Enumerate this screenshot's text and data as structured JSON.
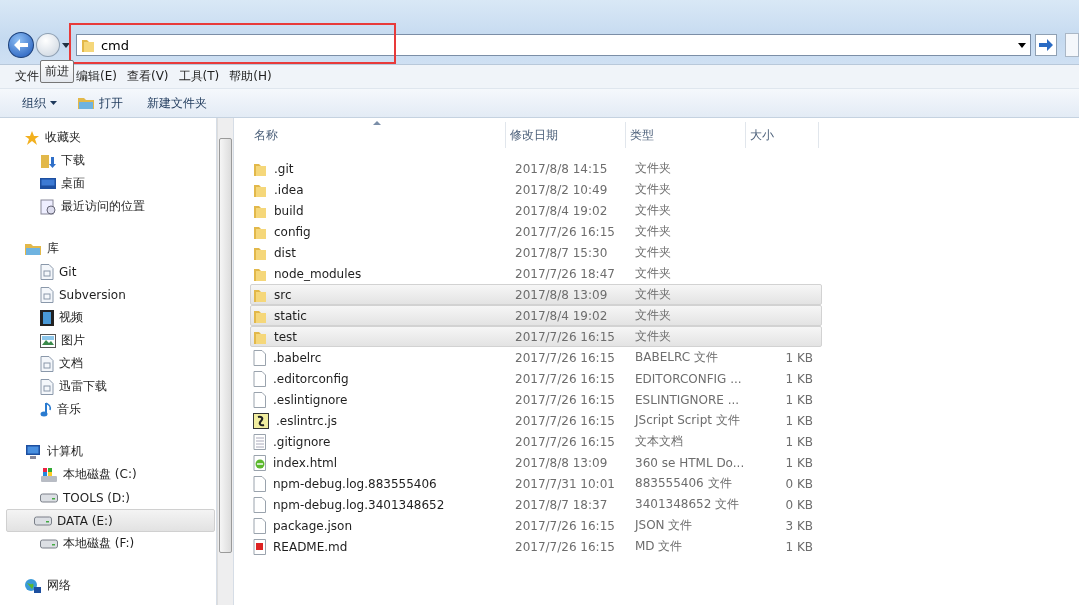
{
  "address_bar": {
    "value": "cmd"
  },
  "tooltip": {
    "text": "前进"
  },
  "menu": [
    "文件",
    "编辑(E)",
    "查看(V)",
    "工具(T)",
    "帮助(H)"
  ],
  "toolbar": [
    {
      "label": "组织",
      "kind": "dropdown"
    },
    {
      "label": "打开",
      "kind": "open"
    },
    {
      "label": "新建文件夹",
      "kind": "plain"
    }
  ],
  "sidebar": {
    "groups": [
      {
        "label": "收藏夹",
        "kind": "star",
        "children": [
          {
            "label": "下载",
            "kind": "download",
            "selected": false
          },
          {
            "label": "桌面",
            "kind": "desktop",
            "selected": false
          },
          {
            "label": "最近访问的位置",
            "kind": "recent",
            "selected": false
          }
        ]
      },
      {
        "label": "库",
        "kind": "library",
        "children": [
          {
            "label": "Git",
            "kind": "doc",
            "selected": false
          },
          {
            "label": "Subversion",
            "kind": "doc",
            "selected": false
          },
          {
            "label": "视频",
            "kind": "film",
            "selected": false
          },
          {
            "label": "图片",
            "kind": "image",
            "selected": false
          },
          {
            "label": "文档",
            "kind": "doc",
            "selected": false
          },
          {
            "label": "迅雷下载",
            "kind": "doc",
            "selected": false
          },
          {
            "label": "音乐",
            "kind": "music",
            "selected": false
          }
        ]
      },
      {
        "label": "计算机",
        "kind": "computer",
        "children": [
          {
            "label": "本地磁盘 (C:)",
            "kind": "system-drive",
            "selected": false
          },
          {
            "label": "TOOLS (D:)",
            "kind": "drive",
            "selected": false
          },
          {
            "label": "DATA (E:)",
            "kind": "drive",
            "selected": true
          },
          {
            "label": "本地磁盘 (F:)",
            "kind": "drive",
            "selected": false
          }
        ]
      },
      {
        "label": "网络",
        "kind": "network"
      }
    ]
  },
  "table": {
    "columns": [
      "名称",
      "修改日期",
      "类型",
      "大小"
    ],
    "rows": [
      {
        "name": ".git",
        "date": "2017/8/8 14:15",
        "type": "文件夹",
        "kind": "folder",
        "selected": false
      },
      {
        "name": ".idea",
        "date": "2017/8/2 10:49",
        "type": "文件夹",
        "kind": "folder",
        "selected": false
      },
      {
        "name": "build",
        "date": "2017/8/4 19:02",
        "type": "文件夹",
        "kind": "folder",
        "selected": false
      },
      {
        "name": "config",
        "date": "2017/7/26 16:15",
        "type": "文件夹",
        "kind": "folder",
        "selected": false
      },
      {
        "name": "dist",
        "date": "2017/8/7 15:30",
        "type": "文件夹",
        "kind": "folder",
        "selected": false
      },
      {
        "name": "node_modules",
        "date": "2017/7/26 18:47",
        "type": "文件夹",
        "kind": "folder",
        "selected": false
      },
      {
        "name": "src",
        "date": "2017/8/8 13:09",
        "type": "文件夹",
        "kind": "folder",
        "selected": true
      },
      {
        "name": "static",
        "date": "2017/8/4 19:02",
        "type": "文件夹",
        "kind": "folder",
        "selected": true
      },
      {
        "name": "test",
        "date": "2017/7/26 16:15",
        "type": "文件夹",
        "kind": "folder",
        "selected": true
      },
      {
        "name": ".babelrc",
        "date": "2017/7/26 16:15",
        "type": "BABELRC 文件",
        "size": "1 KB",
        "kind": "file",
        "selected": false
      },
      {
        "name": ".editorconfig",
        "date": "2017/7/26 16:15",
        "type": "EDITORCONFIG ...",
        "size": "1 KB",
        "kind": "file",
        "selected": false
      },
      {
        "name": ".eslintignore",
        "date": "2017/7/26 16:15",
        "type": "ESLINTIGNORE ...",
        "size": "1 KB",
        "kind": "file",
        "selected": false
      },
      {
        "name": ".eslintrc.js",
        "date": "2017/7/26 16:15",
        "type": "JScript Script 文件",
        "size": "1 KB",
        "kind": "script",
        "selected": false
      },
      {
        "name": ".gitignore",
        "date": "2017/7/26 16:15",
        "type": "文本文档",
        "size": "1 KB",
        "kind": "text",
        "selected": false
      },
      {
        "name": "index.html",
        "date": "2017/8/8 13:09",
        "type": "360 se HTML Do...",
        "size": "1 KB",
        "kind": "web",
        "selected": false
      },
      {
        "name": "npm-debug.log.883555406",
        "date": "2017/7/31 10:01",
        "type": "883555406 文件",
        "size": "0 KB",
        "kind": "file",
        "selected": false
      },
      {
        "name": "npm-debug.log.3401348652",
        "date": "2017/8/7 18:37",
        "type": "3401348652 文件",
        "size": "0 KB",
        "kind": "file",
        "selected": false
      },
      {
        "name": "package.json",
        "date": "2017/7/26 16:15",
        "type": "JSON 文件",
        "size": "3 KB",
        "kind": "file",
        "selected": false
      },
      {
        "name": "README.md",
        "date": "2017/7/26 16:15",
        "type": "MD 文件",
        "size": "1 KB",
        "kind": "pdf",
        "selected": false
      }
    ]
  }
}
